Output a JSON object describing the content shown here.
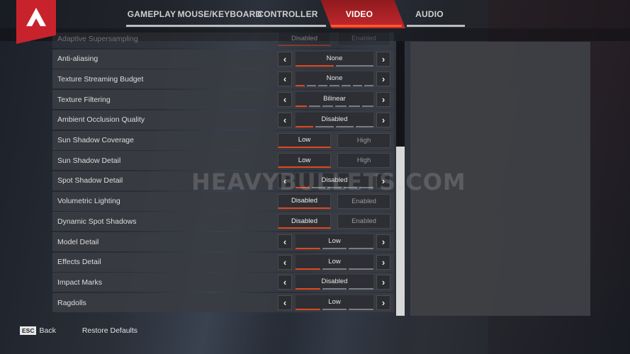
{
  "header": {
    "logo": "apex-legends-logo",
    "tabs": [
      {
        "label": "GAMEPLAY",
        "active": false
      },
      {
        "label": "MOUSE/KEYBOARD",
        "active": false
      },
      {
        "label": "CONTROLLER",
        "active": false
      },
      {
        "label": "VIDEO",
        "active": true
      },
      {
        "label": "AUDIO",
        "active": false
      }
    ]
  },
  "colors": {
    "accent": "#e0481f",
    "logo_red": "#c8232c",
    "active_tab": "#c3282d"
  },
  "settings": [
    {
      "label": "Adaptive Supersampling",
      "type": "toggle",
      "options": [
        "Disabled",
        "Enabled"
      ],
      "selected": 0,
      "partially_visible": true
    },
    {
      "label": "Anti-aliasing",
      "type": "stepper",
      "value": "None",
      "level": 1,
      "levels": 2
    },
    {
      "label": "Texture Streaming Budget",
      "type": "stepper",
      "value": "None",
      "level": 1,
      "levels": 7
    },
    {
      "label": "Texture Filtering",
      "type": "stepper",
      "value": "Bilinear",
      "level": 1,
      "levels": 6
    },
    {
      "label": "Ambient Occlusion Quality",
      "type": "stepper",
      "value": "Disabled",
      "level": 1,
      "levels": 4
    },
    {
      "label": "Sun Shadow Coverage",
      "type": "toggle",
      "options": [
        "Low",
        "High"
      ],
      "selected": 0
    },
    {
      "label": "Sun Shadow Detail",
      "type": "toggle",
      "options": [
        "Low",
        "High"
      ],
      "selected": 0
    },
    {
      "label": "Spot Shadow Detail",
      "type": "stepper",
      "value": "Disabled",
      "level": 1,
      "levels": 5
    },
    {
      "label": "Volumetric Lighting",
      "type": "toggle",
      "options": [
        "Disabled",
        "Enabled"
      ],
      "selected": 0
    },
    {
      "label": "Dynamic Spot Shadows",
      "type": "toggle",
      "options": [
        "Disabled",
        "Enabled"
      ],
      "selected": 0
    },
    {
      "label": "Model Detail",
      "type": "stepper",
      "value": "Low",
      "level": 1,
      "levels": 3
    },
    {
      "label": "Effects Detail",
      "type": "stepper",
      "value": "Low",
      "level": 1,
      "levels": 3
    },
    {
      "label": "Impact Marks",
      "type": "stepper",
      "value": "Disabled",
      "level": 1,
      "levels": 3
    },
    {
      "label": "Ragdolls",
      "type": "stepper",
      "value": "Low",
      "level": 1,
      "levels": 3
    }
  ],
  "icons": {
    "prev": "‹",
    "next": "›"
  },
  "scrollbar": {
    "position_fraction": 0.38
  },
  "watermark": "HEAVYBULLETS.COM",
  "footer": {
    "back_key": "ESC",
    "back_label": "Back",
    "restore_label": "Restore Defaults"
  }
}
